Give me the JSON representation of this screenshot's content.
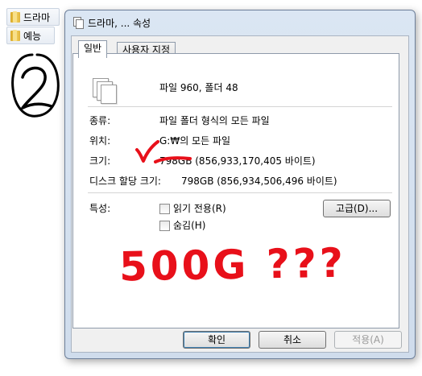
{
  "desktop": {
    "items": [
      {
        "label": "드라마",
        "icon": "folder-icon"
      },
      {
        "label": "예능",
        "icon": "folder-icon"
      }
    ]
  },
  "annotations": {
    "circled_number": "2",
    "note": "500G ???",
    "ink_black": "#000000",
    "ink_red": "#e8101a"
  },
  "dialog": {
    "title": "드라마, ... 속성",
    "tabs": [
      "일반",
      "사용자 지정"
    ],
    "summary": "파일 960, 폴더 48",
    "rows": [
      {
        "label": "종류:",
        "value": "파일 폴더 형식의 모든 파일"
      },
      {
        "label": "위치:",
        "value": "G:₩의 모든 파일"
      },
      {
        "label": "크기:",
        "value": "798GB (856,933,170,405 바이트)"
      },
      {
        "label": "디스크 할당 크기:",
        "value": "798GB (856,934,506,496 바이트)"
      }
    ],
    "attributes_label": "특성:",
    "checkboxes": [
      "읽기 전용(R)",
      "숨김(H)"
    ],
    "advanced_button": "고급(D)...",
    "buttons": {
      "ok": "확인",
      "cancel": "취소",
      "apply": "적용(A)"
    }
  }
}
